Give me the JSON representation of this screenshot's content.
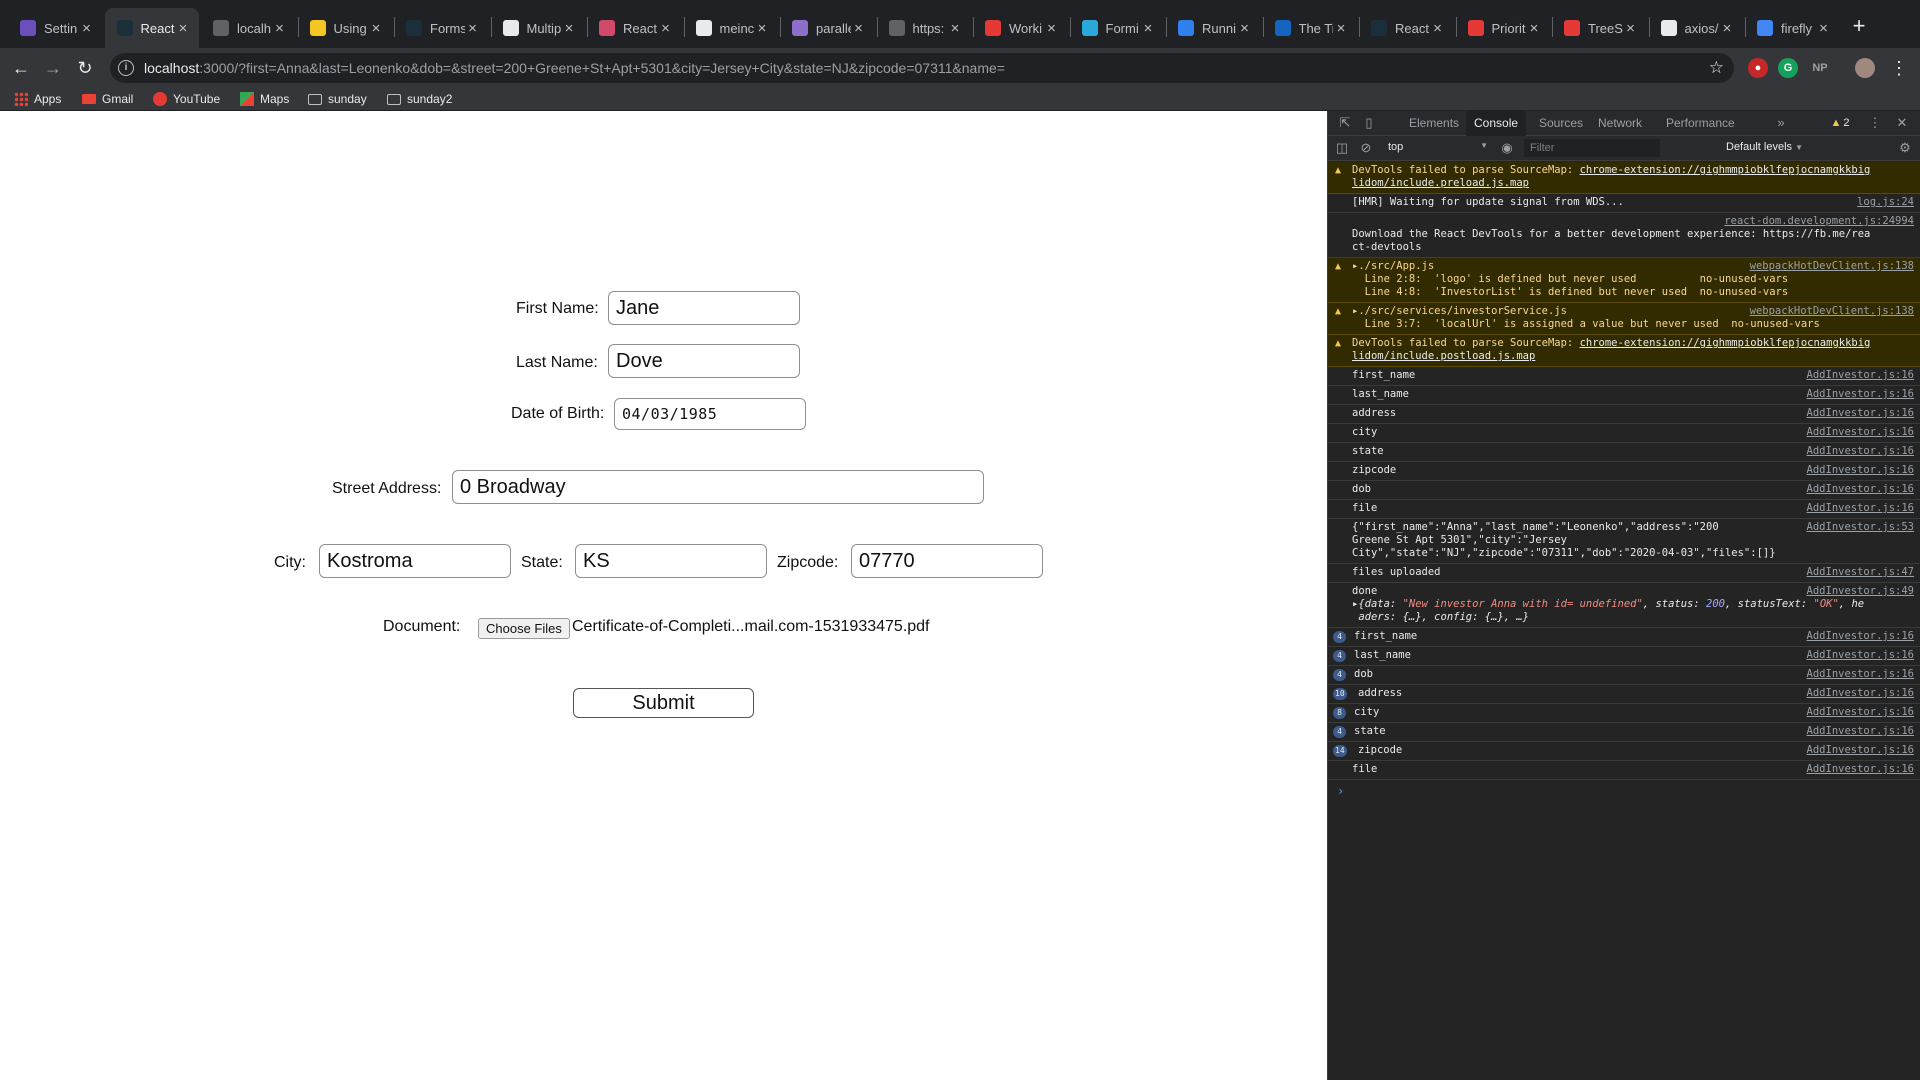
{
  "browser": {
    "tabs": [
      {
        "title": "Settin",
        "icon": "settings-favicon",
        "color": "#6b4fbb"
      },
      {
        "title": "React",
        "icon": "react-favicon",
        "color": "#1a2f3a",
        "active": true
      },
      {
        "title": "localh",
        "icon": "globe-favicon",
        "color": "#5f6368"
      },
      {
        "title": "Using",
        "icon": "python-favicon",
        "color": "#f3c623"
      },
      {
        "title": "Forms",
        "icon": "react-favicon",
        "color": "#1a2f3a"
      },
      {
        "title": "Multip",
        "icon": "openai-favicon",
        "color": "#e8eaed"
      },
      {
        "title": "React",
        "icon": "heart-favicon",
        "color": "#d14a6b"
      },
      {
        "title": "meinc",
        "icon": "github-favicon",
        "color": "#e8eaed"
      },
      {
        "title": "paralle",
        "icon": "hackernoon-favicon",
        "color": "#8d6ec8"
      },
      {
        "title": "https:",
        "icon": "globe-favicon",
        "color": "#5f6368"
      },
      {
        "title": "Worki",
        "icon": "work-favicon",
        "color": "#e53935"
      },
      {
        "title": "Formi",
        "icon": "formik-favicon",
        "color": "#2aa8d8"
      },
      {
        "title": "Runni",
        "icon": "vscode-favicon",
        "color": "#2f80ed"
      },
      {
        "title": "The Ti",
        "icon": "bluetooth-favicon",
        "color": "#1565c0"
      },
      {
        "title": "React",
        "icon": "react-favicon",
        "color": "#1a2f3a"
      },
      {
        "title": "Priorit",
        "icon": "youtube-favicon",
        "color": "#e53935"
      },
      {
        "title": "TreeS",
        "icon": "youtube-favicon",
        "color": "#e53935"
      },
      {
        "title": "axios/",
        "icon": "github-favicon",
        "color": "#e8eaed"
      },
      {
        "title": "firefly",
        "icon": "google-favicon",
        "color": "#4285f4"
      }
    ],
    "url_host": "localhost",
    "url_rest": ":3000/?first=Anna&last=Leonenko&dob=&street=200+Greene+St+Apt+5301&city=Jersey+City&state=NJ&zipcode=07311&name=",
    "profile_initials": "NP",
    "bookmarks": [
      "Apps",
      "Gmail",
      "YouTube",
      "Maps",
      "sunday",
      "sunday2"
    ]
  },
  "form": {
    "first_name_label": "First Name:",
    "first_name_value": "Jane",
    "last_name_label": "Last Name:",
    "last_name_value": "Dove",
    "dob_label": "Date of Birth:",
    "dob_value": "04/03/1985",
    "street_label": "Street Address:",
    "street_value": "0 Broadway",
    "city_label": "City:",
    "city_value": "Kostroma",
    "state_label": "State:",
    "state_value": "KS",
    "zipcode_label": "Zipcode:",
    "zipcode_value": "07770",
    "document_label": "Document:",
    "choose_files_label": "Choose Files",
    "file_name": "Certificate-of-Completi...mail.com-1531933475.pdf",
    "submit_label": "Submit"
  },
  "devtools": {
    "tabs": [
      "Elements",
      "Console",
      "Sources",
      "Network",
      "Performance"
    ],
    "active_tab": "Console",
    "warning_count": "2",
    "context": "top",
    "filter_placeholder": "Filter",
    "levels": "Default levels",
    "messages": [
      {
        "type": "warn",
        "text": "DevTools failed to parse SourceMap: ",
        "link": "chrome-extension://gighmmpiobklfepjocnamgkkbig\nlidom/include.preload.js.map",
        "src": ""
      },
      {
        "type": "log",
        "text": "[HMR] Waiting for update signal from WDS...",
        "src": "log.js:24"
      },
      {
        "type": "log",
        "text": "\nDownload the React DevTools for a better development experience: https://fb.me/rea\nct-devtools",
        "src": "react-dom.development.js:24994"
      },
      {
        "type": "warn",
        "text": "▸./src/App.js\n  Line 2:8:  'logo' is defined but never used          no-unused-vars\n  Line 4:8:  'InvestorList' is defined but never used  no-unused-vars",
        "src": "webpackHotDevClient.js:138"
      },
      {
        "type": "warn",
        "text": "▸./src/services/investorService.js\n  Line 3:7:  'localUrl' is assigned a value but never used  no-unused-vars",
        "src": "webpackHotDevClient.js:138"
      },
      {
        "type": "warn",
        "text": "DevTools failed to parse SourceMap: ",
        "link": "chrome-extension://gighmmpiobklfepjocnamgkkbig\nlidom/include.postload.js.map",
        "src": ""
      },
      {
        "type": "log",
        "text": "first_name",
        "src": "AddInvestor.js:16"
      },
      {
        "type": "log",
        "text": "last_name",
        "src": "AddInvestor.js:16"
      },
      {
        "type": "log",
        "text": "address",
        "src": "AddInvestor.js:16"
      },
      {
        "type": "log",
        "text": "city",
        "src": "AddInvestor.js:16"
      },
      {
        "type": "log",
        "text": "state",
        "src": "AddInvestor.js:16"
      },
      {
        "type": "log",
        "text": "zipcode",
        "src": "AddInvestor.js:16"
      },
      {
        "type": "log",
        "text": "dob",
        "src": "AddInvestor.js:16"
      },
      {
        "type": "log",
        "text": "file",
        "src": "AddInvestor.js:16"
      },
      {
        "type": "log",
        "text": "{\"first_name\":\"Anna\",\"last_name\":\"Leonenko\",\"address\":\"200\nGreene St Apt 5301\",\"city\":\"Jersey\nCity\",\"state\":\"NJ\",\"zipcode\":\"07311\",\"dob\":\"2020-04-03\",\"files\":[]}",
        "src": "AddInvestor.js:53"
      },
      {
        "type": "log",
        "text": "files uploaded",
        "src": "AddInvestor.js:47"
      },
      {
        "type": "log",
        "text": "done\n▸{data: \"New investor Anna with id= undefined\", status: 200, statusText: \"OK\", he\n aders: {…}, config: {…}, …}",
        "src": "AddInvestor.js:49"
      },
      {
        "type": "log",
        "badge": "4",
        "text": "first_name",
        "src": "AddInvestor.js:16"
      },
      {
        "type": "log",
        "badge": "4",
        "text": "last_name",
        "src": "AddInvestor.js:16"
      },
      {
        "type": "log",
        "badge": "4",
        "text": "dob",
        "src": "AddInvestor.js:16"
      },
      {
        "type": "log",
        "badge": "10",
        "text": "address",
        "src": "AddInvestor.js:16"
      },
      {
        "type": "log",
        "badge": "8",
        "text": "city",
        "src": "AddInvestor.js:16"
      },
      {
        "type": "log",
        "badge": "4",
        "text": "state",
        "src": "AddInvestor.js:16"
      },
      {
        "type": "log",
        "badge": "14",
        "text": "zipcode",
        "src": "AddInvestor.js:16"
      },
      {
        "type": "log",
        "text": "file",
        "src": "AddInvestor.js:16"
      }
    ]
  }
}
